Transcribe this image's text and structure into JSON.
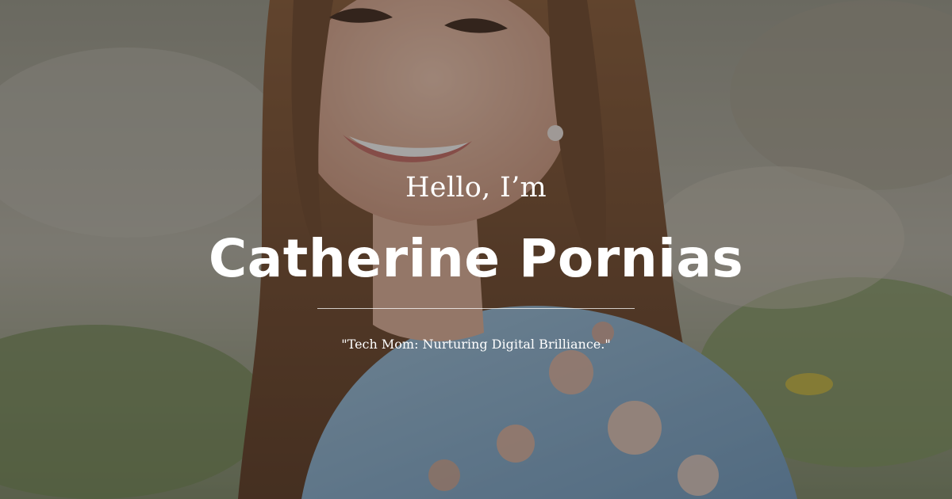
{
  "hero": {
    "greeting": "Hello, I’m",
    "name": "Catherine Pornias",
    "tagline": "\"Tech Mom: Nurturing Digital Brilliance.\"",
    "background_image": "portrait-photo",
    "overlay_color": "#282624"
  }
}
